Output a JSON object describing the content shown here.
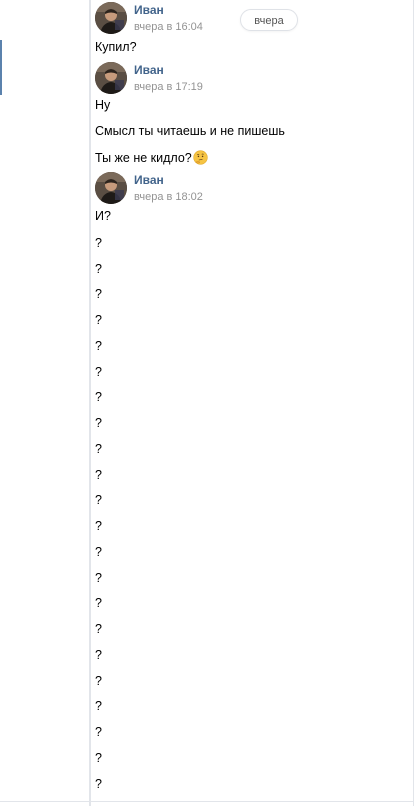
{
  "date_badge": "вчера",
  "groups": [
    {
      "author": "Иван",
      "time": "вчера в 16:04",
      "messages": [
        "Купил?"
      ]
    },
    {
      "author": "Иван",
      "time": "вчера в 17:19",
      "messages": [
        "Ну",
        "Смысл ты читаешь и не пишешь",
        "Ты же не кидло?"
      ],
      "emoji": "thinking-face-icon"
    },
    {
      "author": "Иван",
      "time": "вчера в 18:02",
      "messages": [
        "И?",
        "?",
        "?",
        "?",
        "?",
        "?",
        "?",
        "?",
        "?",
        "?",
        "?",
        "?",
        "?",
        "?",
        "?",
        "?",
        "?",
        "?",
        "?",
        "?",
        "?",
        "?",
        "?"
      ]
    }
  ],
  "colors": {
    "author": "#42648b",
    "time": "#939393",
    "accent": "#5b82ad",
    "border": "#e2e5ea"
  }
}
